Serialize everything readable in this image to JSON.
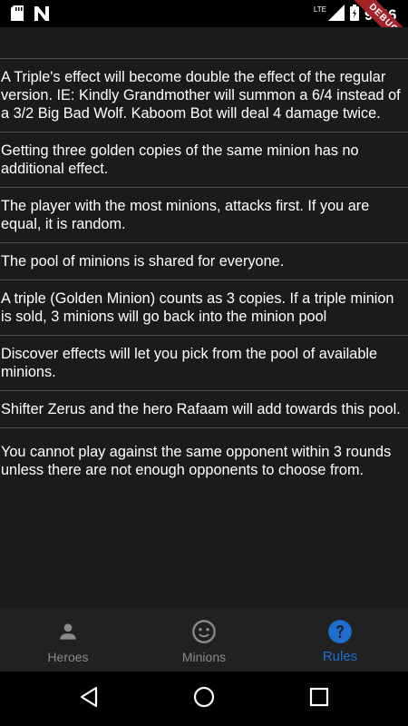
{
  "status_bar": {
    "time": "9:56",
    "network_label": "LTE",
    "debug_label": "DEBUG"
  },
  "rules": [
    "A Triple's effect will become double the effect of the regular version. IE: Kindly Grandmother will summon a 6/4 instead of a 3/2 Big Bad Wolf. Kaboom Bot will deal 4 damage twice.",
    "Getting three golden copies of the same minion has no additional effect.",
    "The player with the most minions, attacks first. If you are equal, it is random.",
    "The pool of minions is shared for everyone.",
    "A triple (Golden Minion) counts as 3 copies. If a triple minion is sold, 3 minions will go back into the minion pool",
    "Discover effects will let you pick from the pool of available minions.",
    "Shifter Zerus and the hero Rafaam will add towards this pool.",
    "You cannot play against the same opponent within 3 rounds unless there are not enough opponents to choose from."
  ],
  "bottom_nav": {
    "items": [
      {
        "label": "Heroes",
        "icon": "person-icon",
        "active": false
      },
      {
        "label": "Minions",
        "icon": "face-icon",
        "active": false
      },
      {
        "label": "Rules",
        "icon": "help-icon",
        "active": true
      }
    ],
    "active_color": "#1f6fd1",
    "inactive_color": "#8a8a8a"
  },
  "system_nav": {
    "buttons": [
      "back-icon",
      "home-icon",
      "recents-icon"
    ]
  }
}
